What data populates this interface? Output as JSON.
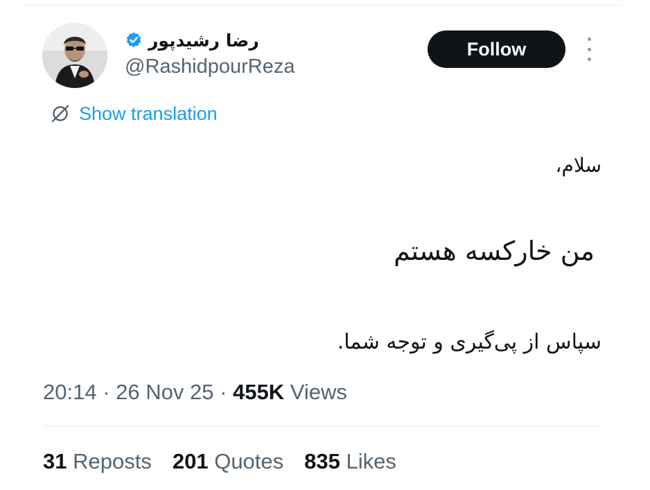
{
  "author": {
    "display_name": "رضا رشیدپور",
    "handle": "@RashidpourReza",
    "verified_color": "#1d9bf0",
    "avatar_icon": "profile-photo"
  },
  "actions": {
    "follow_label": "Follow",
    "more_icon": "vertical-ellipsis"
  },
  "translation": {
    "label": "Show translation",
    "icon": "translate-globe-slash"
  },
  "tweet": {
    "lines": [
      "سلام،",
      "من خارکسه هستم",
      "سپاس از پی‌گیری و توجه شما."
    ]
  },
  "meta": {
    "time": "20:14",
    "separator": " · ",
    "date": "26 Nov 25",
    "views_count": "455K",
    "views_label": "Views"
  },
  "stats": {
    "reposts_count": "31",
    "reposts_label": "Reposts",
    "quotes_count": "201",
    "quotes_label": "Quotes",
    "likes_count": "835",
    "likes_label": "Likes"
  },
  "colors": {
    "link_blue": "#1d9bf0",
    "secondary_text": "#536471",
    "primary_text": "#0f1419",
    "button_bg": "#0f1419"
  }
}
